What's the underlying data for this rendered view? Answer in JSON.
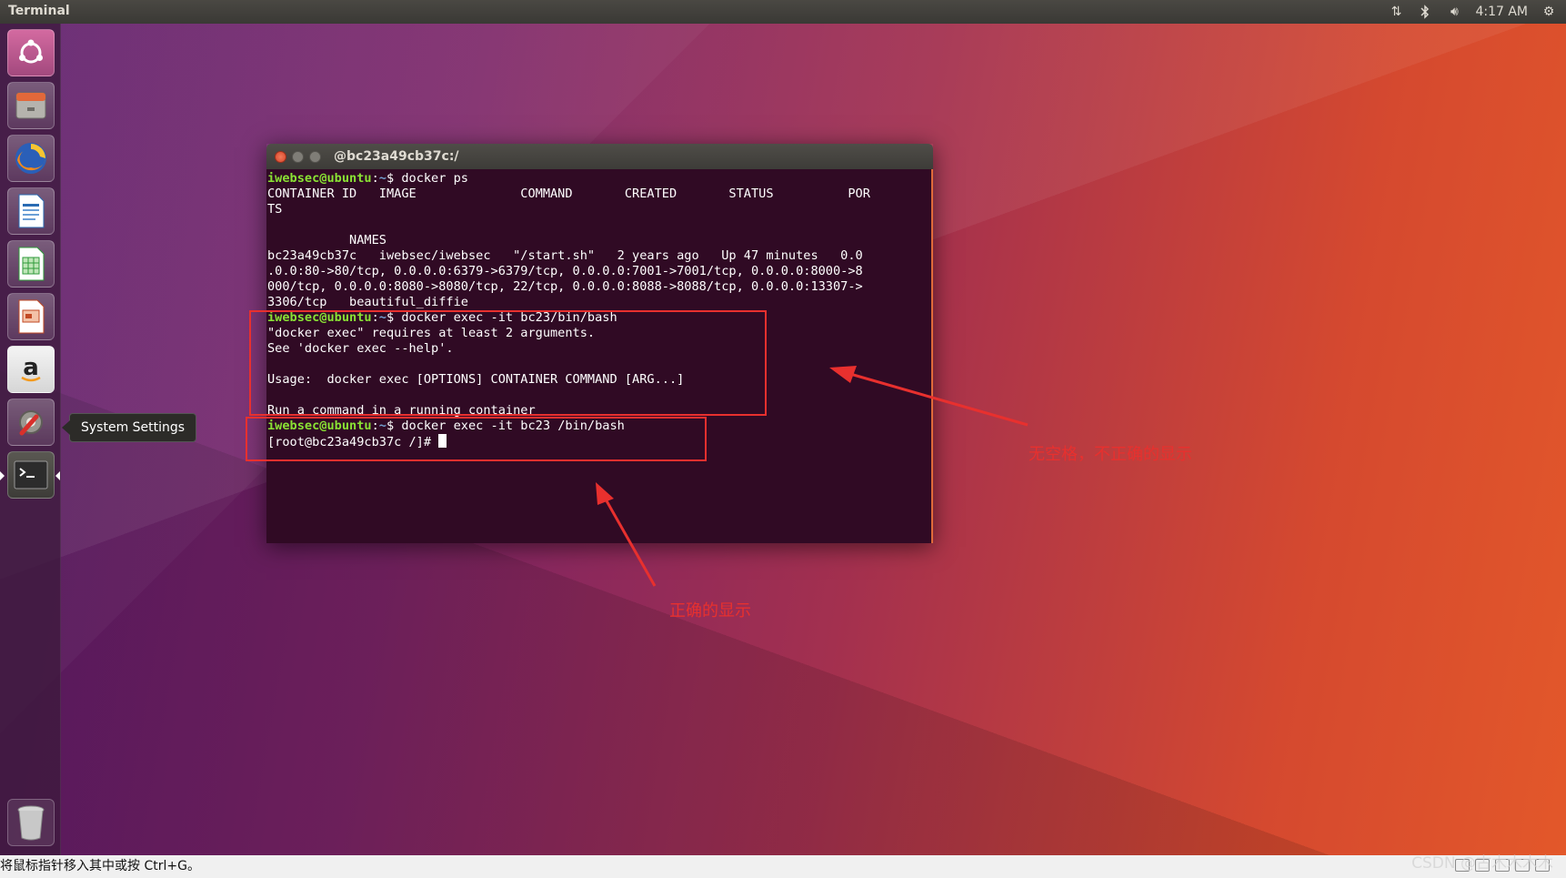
{
  "top_panel": {
    "app_title": "Terminal",
    "clock": "4:17 AM",
    "tray_icons": [
      "network-updown-icon",
      "bluetooth-icon",
      "volume-icon",
      "settings-gear-icon"
    ]
  },
  "launcher": {
    "items": [
      {
        "name": "dash-home",
        "icon": "ubuntu-logo-icon"
      },
      {
        "name": "files",
        "icon": "file-cabinet-icon"
      },
      {
        "name": "firefox",
        "icon": "firefox-icon"
      },
      {
        "name": "libreoffice-writer",
        "icon": "writer-document-icon"
      },
      {
        "name": "libreoffice-calc",
        "icon": "calc-spreadsheet-icon"
      },
      {
        "name": "libreoffice-impress",
        "icon": "impress-presentation-icon"
      },
      {
        "name": "amazon",
        "icon": "amazon-icon"
      },
      {
        "name": "system-settings",
        "icon": "settings-wrench-icon"
      },
      {
        "name": "terminal",
        "icon": "terminal-icon"
      },
      {
        "name": "trash",
        "icon": "trash-icon"
      }
    ],
    "tooltip": "System Settings"
  },
  "terminal": {
    "title": "@bc23a49cb37c:/",
    "prompt_user": "iwebsec@ubuntu",
    "prompt_path": "~",
    "lines": [
      {
        "kind": "prompt",
        "cmd": "$ docker ps"
      },
      {
        "kind": "out",
        "text": "CONTAINER ID   IMAGE              COMMAND       CREATED       STATUS          POR"
      },
      {
        "kind": "out",
        "text": "TS"
      },
      {
        "kind": "out",
        "text": ""
      },
      {
        "kind": "out",
        "text": "           NAMES"
      },
      {
        "kind": "out",
        "text": "bc23a49cb37c   iwebsec/iwebsec   \"/start.sh\"   2 years ago   Up 47 minutes   0.0"
      },
      {
        "kind": "out",
        "text": ".0.0:80->80/tcp, 0.0.0.0:6379->6379/tcp, 0.0.0.0:7001->7001/tcp, 0.0.0.0:8000->8"
      },
      {
        "kind": "out",
        "text": "000/tcp, 0.0.0.0:8080->8080/tcp, 22/tcp, 0.0.0.0:8088->8088/tcp, 0.0.0.0:13307->"
      },
      {
        "kind": "out",
        "text": "3306/tcp   beautiful_diffie"
      },
      {
        "kind": "prompt",
        "cmd": "$ docker exec -it bc23/bin/bash"
      },
      {
        "kind": "out",
        "text": "\"docker exec\" requires at least 2 arguments."
      },
      {
        "kind": "out",
        "text": "See 'docker exec --help'."
      },
      {
        "kind": "out",
        "text": ""
      },
      {
        "kind": "out",
        "text": "Usage:  docker exec [OPTIONS] CONTAINER COMMAND [ARG...]"
      },
      {
        "kind": "out",
        "text": ""
      },
      {
        "kind": "out",
        "text": "Run a command in a running container"
      },
      {
        "kind": "prompt",
        "cmd": "$ docker exec -it bc23 /bin/bash"
      },
      {
        "kind": "root",
        "text": "[root@bc23a49cb37c /]# "
      }
    ]
  },
  "annotations": {
    "wrong_label": "无空格，不正确的显示",
    "right_label": "正确的显示",
    "color": "#e8302e"
  },
  "status_bar": {
    "message": "将鼠标指针移入其中或按 Ctrl+G。"
  },
  "watermark": "CSDN @古木木木木"
}
